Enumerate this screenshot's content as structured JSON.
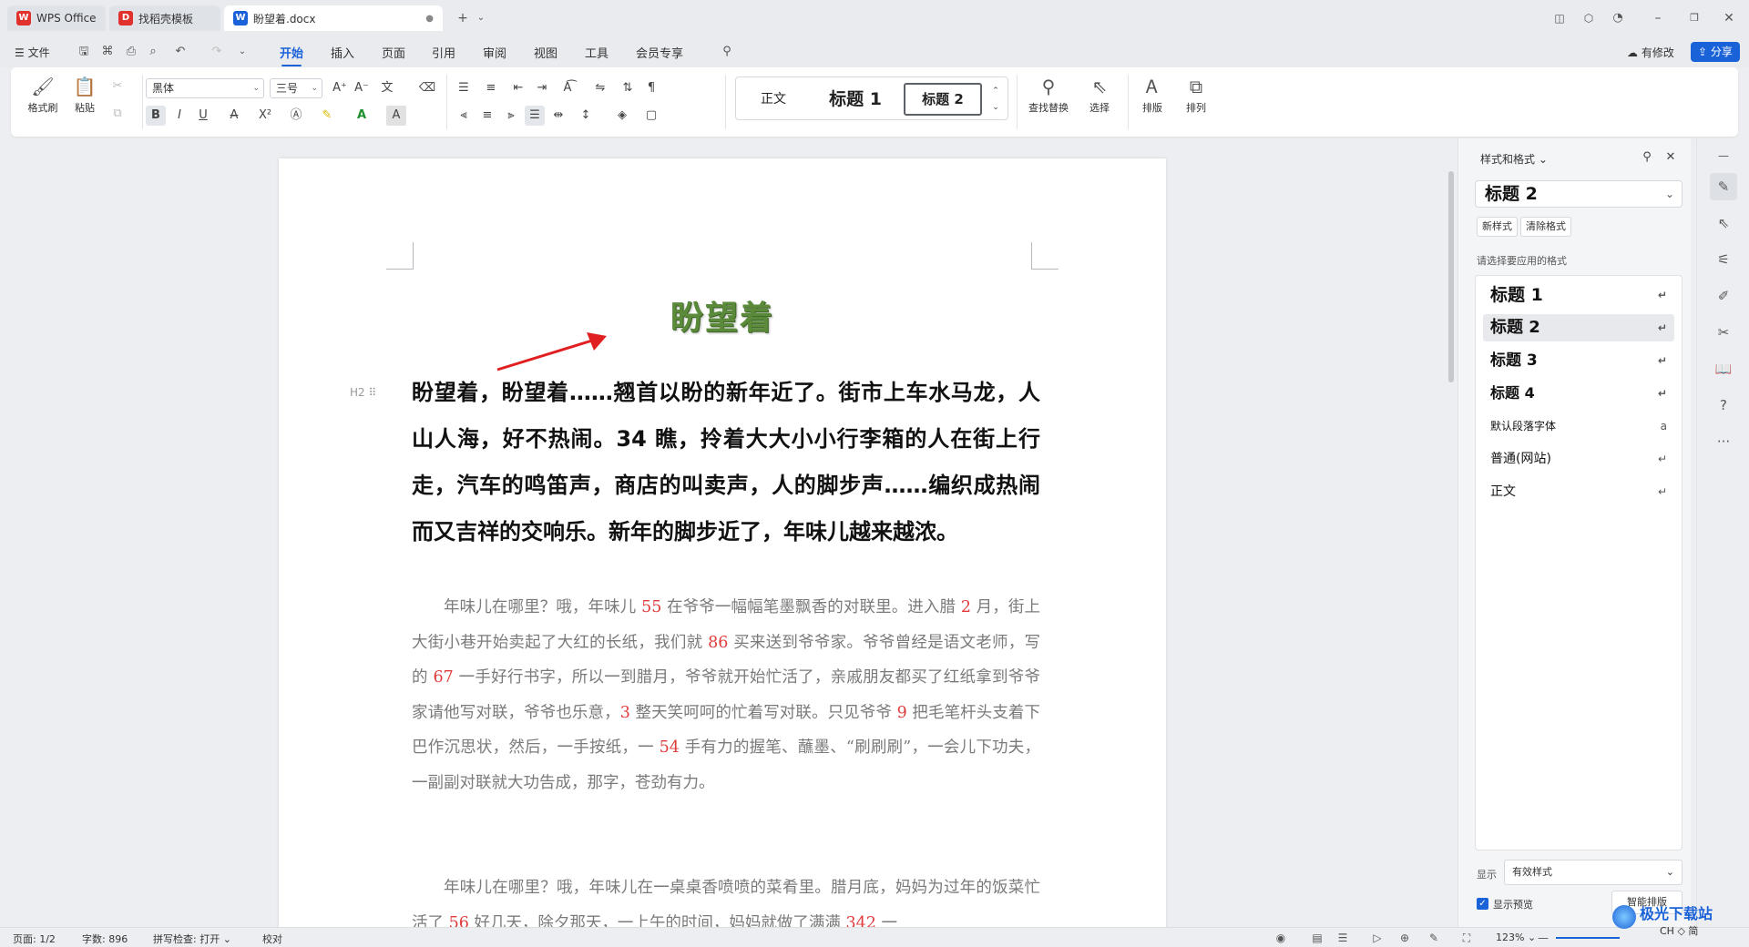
{
  "tabs": [
    {
      "label": "WPS Office",
      "icon": "wps-logo-icon"
    },
    {
      "label": "找稻壳模板",
      "icon": "docer-icon"
    },
    {
      "label": "盼望着.docx",
      "icon": "word-doc-icon"
    }
  ],
  "menu": {
    "file": "文件",
    "items": [
      "开始",
      "插入",
      "页面",
      "引用",
      "审阅",
      "视图",
      "工具",
      "会员专享"
    ],
    "active": "开始",
    "modified": "有修改",
    "share": "分享"
  },
  "ribbon": {
    "format_painter": "格式刷",
    "paste": "粘贴",
    "font_name": "黑体",
    "font_size": "三号",
    "styles": [
      "正文",
      "标题 1",
      "标题 2"
    ],
    "selected_style": "标题 2",
    "find_replace": "查找替换",
    "select": "选择",
    "layout": "排版",
    "arrange": "排列"
  },
  "document": {
    "title": "盼望着",
    "heading_para": "盼望着，盼望着……翘首以盼的新年近了。街市上车水马龙，人山人海，好不热闹。34 瞧，拎着大大小小行李箱的人在街上行走，汽车的鸣笛声，商店的叫卖声，人的脚步声……编织成热闹而又吉祥的交响乐。新年的脚步近了，年味儿越来越浓。",
    "heading_mark": "H2",
    "para1": [
      {
        "t": "年味儿在哪里？哦，年味儿 "
      },
      {
        "t": "55",
        "red": true
      },
      {
        "t": " 在爷爷一幅幅笔墨飘香的对联里。进入腊 "
      },
      {
        "t": "2",
        "red": true
      },
      {
        "t": " 月，街上大街小巷开始卖起了大红的长纸，我们就 "
      },
      {
        "t": "86",
        "red": true
      },
      {
        "t": " 买来送到爷爷家。爷爷曾经是语文老师，写的 "
      },
      {
        "t": "67",
        "red": true
      },
      {
        "t": " 一手好行书字，所以一到腊月，爷爷就开始忙活了，亲戚朋友都买了红纸拿到爷爷家请他写对联，爷爷也乐意，"
      },
      {
        "t": "3",
        "red": true
      },
      {
        "t": " 整天笑呵呵的忙着写对联。只见爷爷 "
      },
      {
        "t": "9",
        "red": true
      },
      {
        "t": " 把毛笔杆头支着下巴作沉思状，然后，一手按纸，一 "
      },
      {
        "t": "54",
        "red": true
      },
      {
        "t": " 手有力的握笔、蘸墨、“刷刷刷”，一会儿下功夫，一副副对联就大功告成，那字，苍劲有力。"
      }
    ],
    "para2": [
      {
        "t": "年味儿在哪里？哦，年味儿在一桌桌香喷喷的菜肴里。腊月底，妈妈为过年的饭菜忙活了 "
      },
      {
        "t": "56",
        "red": true
      },
      {
        "t": " 好几天，除夕那天，一上午的时间，妈妈就做了满满 "
      },
      {
        "t": "342",
        "red": true
      },
      {
        "t": " 一"
      }
    ]
  },
  "panel": {
    "header": "样式和格式",
    "current_style": "标题 2",
    "new_style": "新样式",
    "clear_format": "清除格式",
    "choose_label": "请选择要应用的格式",
    "list": [
      {
        "name": "标题 1",
        "mark": "↵"
      },
      {
        "name": "标题 2",
        "mark": "↵"
      },
      {
        "name": "标题 3",
        "mark": "↵"
      },
      {
        "name": "标题 4",
        "mark": "↵"
      },
      {
        "name": "默认段落字体",
        "mark": "a"
      },
      {
        "name": "普通(网站)",
        "mark": "↵"
      },
      {
        "name": "正文",
        "mark": "↵"
      }
    ],
    "show_label": "显示",
    "show_value": "有效样式",
    "preview_label": "显示预览",
    "smart_layout": "智能排版"
  },
  "status": {
    "page": "页面: 1/2",
    "words": "字数: 896",
    "spell": "拼写检查: 打开",
    "proof": "校对",
    "zoom": "123%"
  },
  "watermark": "极光下载站",
  "watermark_sub": "CH ◇ 简",
  "colors": {
    "accent": "#1a62d8",
    "title_green": "#5a8a3a",
    "red_num": "#e03b3b",
    "arrow": "#e02020"
  }
}
